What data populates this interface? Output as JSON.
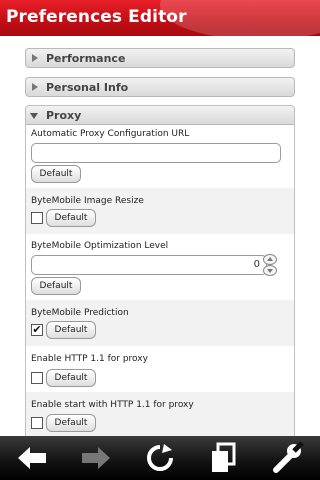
{
  "app": {
    "title": "Preferences Editor"
  },
  "sections": {
    "performance": "Performance",
    "personal_info": "Personal Info",
    "proxy": "Proxy"
  },
  "prefs": {
    "auto_proxy": {
      "label": "Automatic Proxy Configuration URL",
      "value": "",
      "default_label": "Default"
    },
    "image_resize": {
      "label": "ByteMobile Image Resize",
      "checked": false,
      "default_label": "Default"
    },
    "opt_level": {
      "label": "ByteMobile Optimization Level",
      "value": "0",
      "default_label": "Default"
    },
    "prediction": {
      "label": "ByteMobile Prediction",
      "checked": true,
      "check_glyph": "✔",
      "default_label": "Default"
    },
    "http11_proxy": {
      "label": "Enable HTTP 1.1 for proxy",
      "checked": false,
      "default_label": "Default"
    },
    "start_http11": {
      "label": "Enable start with HTTP 1.1 for proxy",
      "checked": false,
      "default_label": "Default"
    }
  },
  "toolbar": {
    "icons": [
      "back-arrow-icon",
      "forward-arrow-icon",
      "reload-icon",
      "tabs-icon",
      "wrench-icon"
    ]
  },
  "colors": {
    "title_bar": "#d0141c",
    "toolbar": "#1a1a1a",
    "icon": "#ffffff",
    "icon_disabled": "#777777"
  }
}
